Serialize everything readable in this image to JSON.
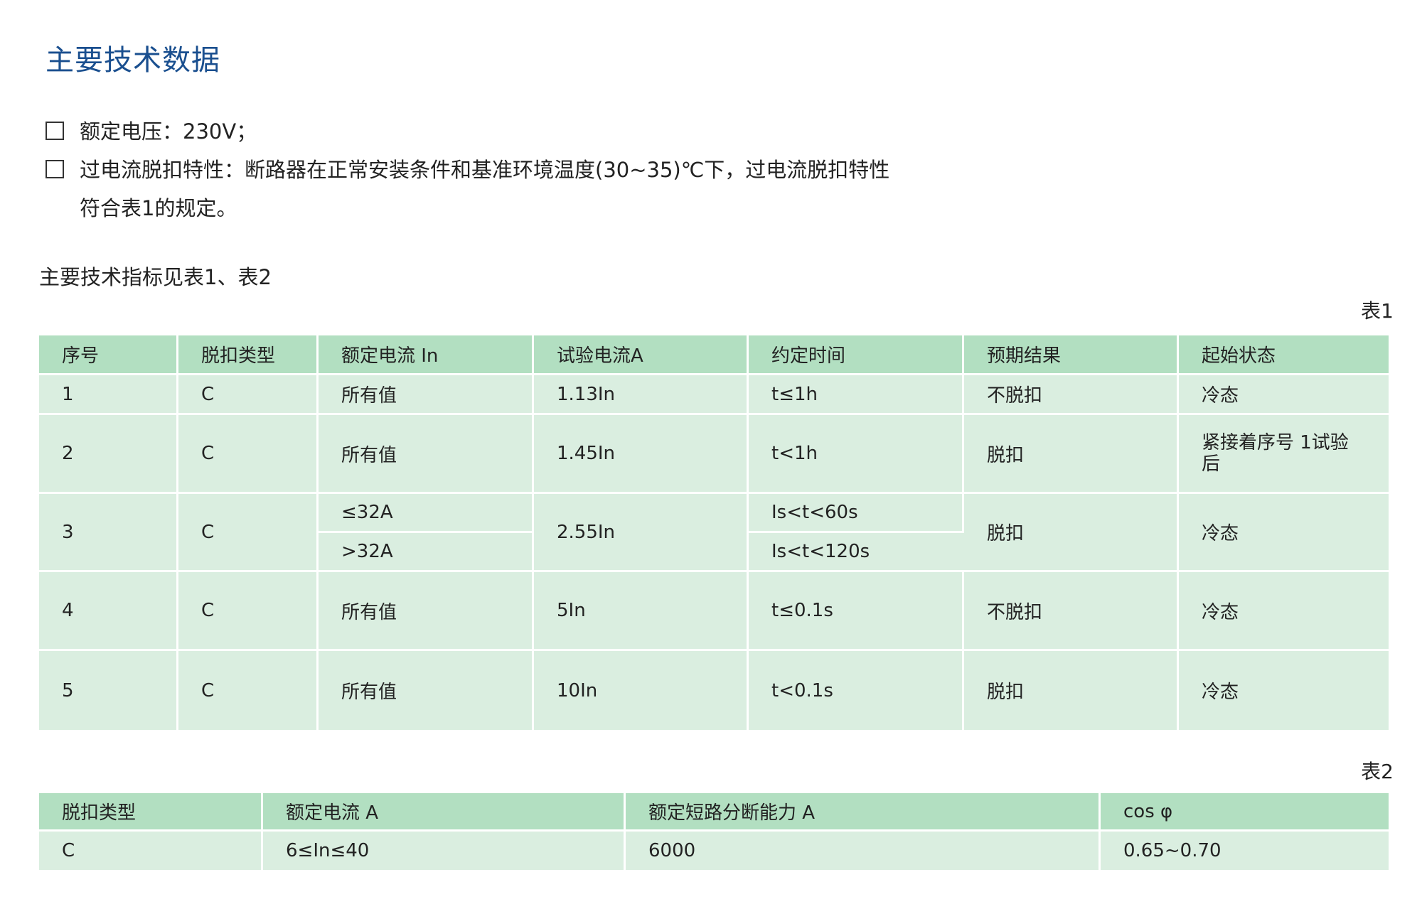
{
  "page": {
    "title": "主要技术数据",
    "bullets": [
      {
        "text": "额定电压：230V；"
      },
      {
        "text": "过电流脱扣特性：断路器在正常安装条件和基准环境温度(30~35)℃下，过电流脱扣特性",
        "continuation": "符合表1的规定。"
      }
    ],
    "subtitle": "主要技术指标见表1、表2"
  },
  "table1": {
    "caption": "表1",
    "headers": [
      "序号",
      "脱扣类型",
      "额定电流  In",
      "试验电流A",
      "约定时间",
      "预期结果",
      "起始状态"
    ],
    "rows": [
      {
        "no": "1",
        "type": "C",
        "current": "所有值",
        "test": "1.13In",
        "time": "t≤1h",
        "result": "不脱扣",
        "state": "冷态"
      },
      {
        "no": "2",
        "type": "C",
        "current": "所有值",
        "test": "1.45In",
        "time": "t<1h",
        "result": "脱扣",
        "state": "紧接着序号 1试验后"
      },
      {
        "no": "3",
        "type": "C",
        "current_a": "≤32A",
        "current_b": ">32A",
        "test": "2.55In",
        "time_a": "Is<t<60s",
        "time_b": "Is<t<120s",
        "result": "脱扣",
        "state": "冷态"
      },
      {
        "no": "4",
        "type": "C",
        "current": "所有值",
        "test": "5In",
        "time": "t≤0.1s",
        "result": "不脱扣",
        "state": "冷态"
      },
      {
        "no": "5",
        "type": "C",
        "current": "所有值",
        "test": "10In",
        "time": "t<0.1s",
        "result": "脱扣",
        "state": "冷态"
      }
    ]
  },
  "table2": {
    "caption": "表2",
    "headers": [
      "脱扣类型",
      "额定电流  A",
      "额定短路分断能力  A",
      "cos φ"
    ],
    "rows": [
      {
        "type": "C",
        "current": "6≤In≤40",
        "capacity": "6000",
        "cos": "0.65~0.70"
      }
    ]
  },
  "colors": {
    "title": "#1a4f8f",
    "header_bg": "#b2dfc1",
    "row_bg": "#daeee0"
  }
}
